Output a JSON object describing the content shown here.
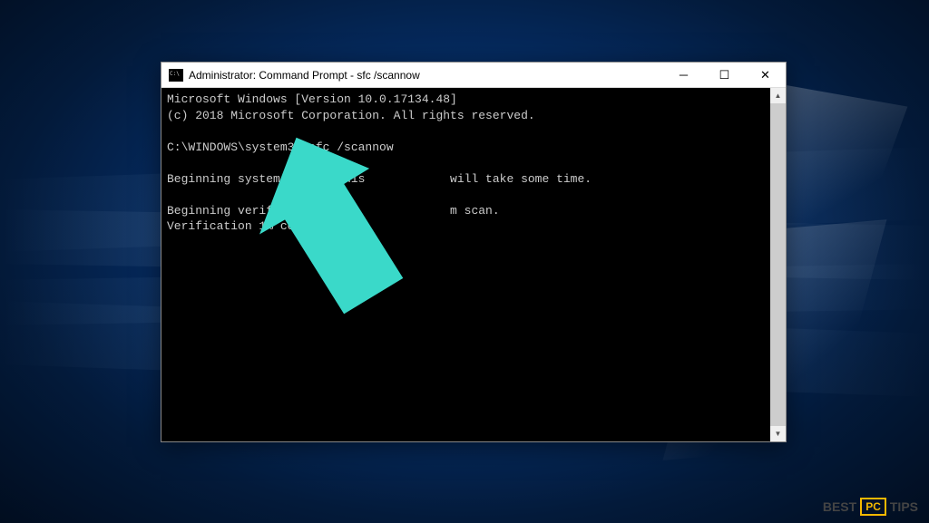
{
  "window": {
    "title": "Administrator: Command Prompt - sfc  /scannow",
    "buttons": {
      "minimize": "─",
      "maximize": "☐",
      "close": "✕"
    }
  },
  "console": {
    "line1": "Microsoft Windows [Version 10.0.17134.48]",
    "line2": "(c) 2018 Microsoft Corporation. All rights reserved.",
    "blank1": "",
    "prompt_line": "C:\\WINDOWS\\system32>sfc /scannow",
    "blank2": "",
    "scan_line": "Beginning system scan.  This            will take some time.",
    "blank3": "",
    "verify_line1": "Beginning verification phas             m scan.",
    "verify_line2": "Verification 1% complete."
  },
  "scrollbar": {
    "up": "▲",
    "down": "▼"
  },
  "watermark": {
    "prefix": "BEST",
    "pc": "PC",
    "suffix": "TIPS"
  },
  "colors": {
    "arrow": "#3ad9c9"
  }
}
